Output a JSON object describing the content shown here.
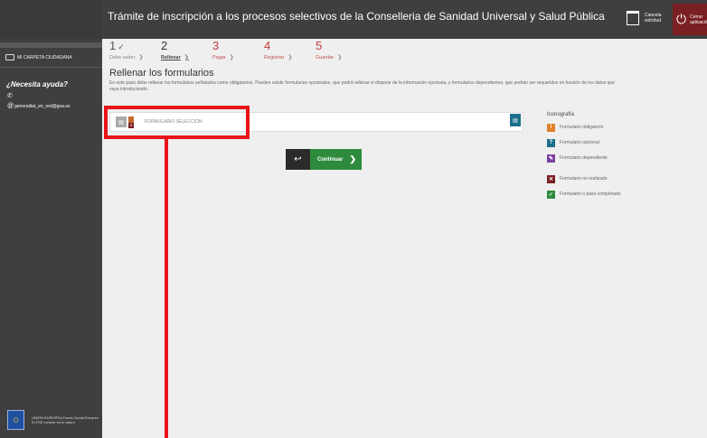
{
  "header": {
    "title": "Trámite de inscripción a los procesos selectivos de la Conselleria de Sanidad Universal y Salud Pública",
    "cancel_label": "Cancela solicitud",
    "exit_label": "Cerrar aplicación"
  },
  "sidebar": {
    "folder_label": "MI CARPETA CIUDADANA",
    "help_title": "¿Necesita ayuda?",
    "email": "generalitat_en_red@gva.es",
    "eu_text": "UNIÓN EUROPEA Fondo Social Europeo El FSE invierte en tu futuro"
  },
  "steps": [
    {
      "num": "1",
      "check": "✓",
      "label": "Debe saber"
    },
    {
      "num": "2",
      "label": "Rellenar"
    },
    {
      "num": "3",
      "label": "Pagar"
    },
    {
      "num": "4",
      "label": "Registrar"
    },
    {
      "num": "5",
      "label": "Guardar"
    }
  ],
  "main": {
    "heading": "Rellenar los formularios",
    "description": "En este paso debe rellenar los formularios señalados como obligatorios. Pueden existir formularios opcionales, que podrá rellenar si dispone de la información oportuna, y formularios dependientes, que podrán ser requeridos en función de los datos que vaya introduciendo.",
    "form_label": "FORMULARIO SELECCIÓN",
    "continue_label": "Continuar"
  },
  "legend": {
    "title": "Iconografía",
    "items": [
      {
        "label": "Formulario obligatorio",
        "color": "#e0822b",
        "glyph": "!"
      },
      {
        "label": "Formulario opcional",
        "color": "#1c6f8a",
        "glyph": "?"
      },
      {
        "label": "Formulario dependiente",
        "color": "#7b3fa0",
        "glyph": "✎"
      },
      {
        "label": "Formulario no realizado",
        "color": "#7a1f22",
        "glyph": "✕"
      },
      {
        "label": "Formulario o paso completado",
        "color": "#2e8b3d",
        "glyph": "✓"
      }
    ]
  },
  "colors": {
    "highlight": "#e8141a",
    "sidebar": "#3f3f3f",
    "continue": "#2e8b3d"
  }
}
